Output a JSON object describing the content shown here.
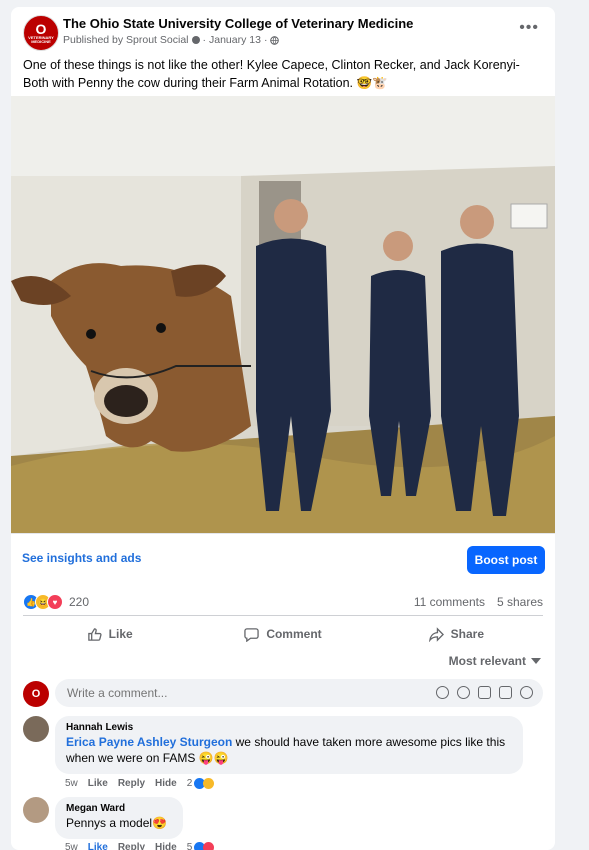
{
  "post": {
    "author": "The Ohio State University College of Veterinary Medicine",
    "avatar_letter": "O",
    "avatar_text": "VETERINARY MEDICINE",
    "publisher": "Published by Sprout Social",
    "date": "January 13",
    "separator": "·",
    "more_icon": "•••",
    "text": "One of these things is not like the other! Kylee Capece, Clinton Recker, and Jack Korenyi-Both with Penny the cow during their Farm Animal Rotation. 🤓🐮"
  },
  "insights_bar": {
    "insights_link": "See insights and ads",
    "boost_label": "Boost post"
  },
  "stats": {
    "reaction_count": "220",
    "comments": "11 comments",
    "shares": "5 shares"
  },
  "actions": {
    "like": "Like",
    "comment": "Comment",
    "share": "Share"
  },
  "sort": {
    "label": "Most relevant"
  },
  "composer": {
    "placeholder": "Write a comment..."
  },
  "comments": [
    {
      "name": "Hannah Lewis",
      "tags": "Erica Payne Ashley Sturgeon",
      "text": "we should have taken more awesome pics like this when we were on FAMS 😜😜",
      "time": "5w",
      "like": "Like",
      "reply": "Reply",
      "hide": "Hide",
      "reactions": "2"
    },
    {
      "name": "Megan Ward",
      "text": "Pennys a model😍",
      "time": "5w",
      "like": "Like",
      "reply": "Reply",
      "hide": "Hide",
      "reactions": "5"
    }
  ],
  "colors": {
    "accent": "#0866ff",
    "link": "#216fdb",
    "brand": "#bb0000"
  }
}
